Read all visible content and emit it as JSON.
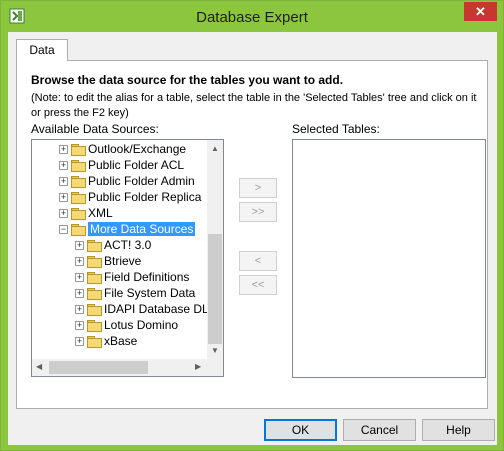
{
  "window": {
    "title": "Database Expert",
    "close_glyph": "✕"
  },
  "tabs": [
    {
      "label": "Data"
    }
  ],
  "main": {
    "heading": "Browse the data source for the tables you want to add.",
    "note": "(Note: to edit the alias for a table, select the table in the 'Selected Tables' tree and click on it or press the F2 key)",
    "available_label": "Available Data Sources:",
    "selected_label": "Selected Tables:"
  },
  "tree": {
    "expander_glyphs": {
      "collapsed": "+",
      "expanded": "−"
    },
    "items": [
      {
        "label": "Outlook/Exchange",
        "level": 0,
        "expanded": false,
        "selected": false
      },
      {
        "label": "Public Folder ACL",
        "level": 0,
        "expanded": false,
        "selected": false
      },
      {
        "label": "Public Folder Admin",
        "level": 0,
        "expanded": false,
        "selected": false
      },
      {
        "label": "Public Folder Replica",
        "level": 0,
        "expanded": false,
        "selected": false
      },
      {
        "label": "XML",
        "level": 0,
        "expanded": false,
        "selected": false
      },
      {
        "label": "More Data Sources",
        "level": 0,
        "expanded": true,
        "selected": true
      },
      {
        "label": "ACT! 3.0",
        "level": 1,
        "expanded": false,
        "selected": false
      },
      {
        "label": "Btrieve",
        "level": 1,
        "expanded": false,
        "selected": false
      },
      {
        "label": "Field Definitions",
        "level": 1,
        "expanded": false,
        "selected": false
      },
      {
        "label": "File System Data",
        "level": 1,
        "expanded": false,
        "selected": false
      },
      {
        "label": "IDAPI Database DL",
        "level": 1,
        "expanded": false,
        "selected": false
      },
      {
        "label": "Lotus Domino",
        "level": 1,
        "expanded": false,
        "selected": false
      },
      {
        "label": "xBase",
        "level": 1,
        "expanded": false,
        "selected": false
      }
    ]
  },
  "move_buttons": {
    "add": ">",
    "add_all": ">>",
    "remove": "<",
    "remove_all": "<<"
  },
  "scroll_glyphs": {
    "up": "▲",
    "down": "▼",
    "left": "◀",
    "right": "▶"
  },
  "buttons": {
    "ok": "OK",
    "cancel": "Cancel",
    "help": "Help"
  },
  "colors": {
    "titlebar": "#8cc63f",
    "selection": "#3399ff",
    "close": "#c7372f"
  }
}
